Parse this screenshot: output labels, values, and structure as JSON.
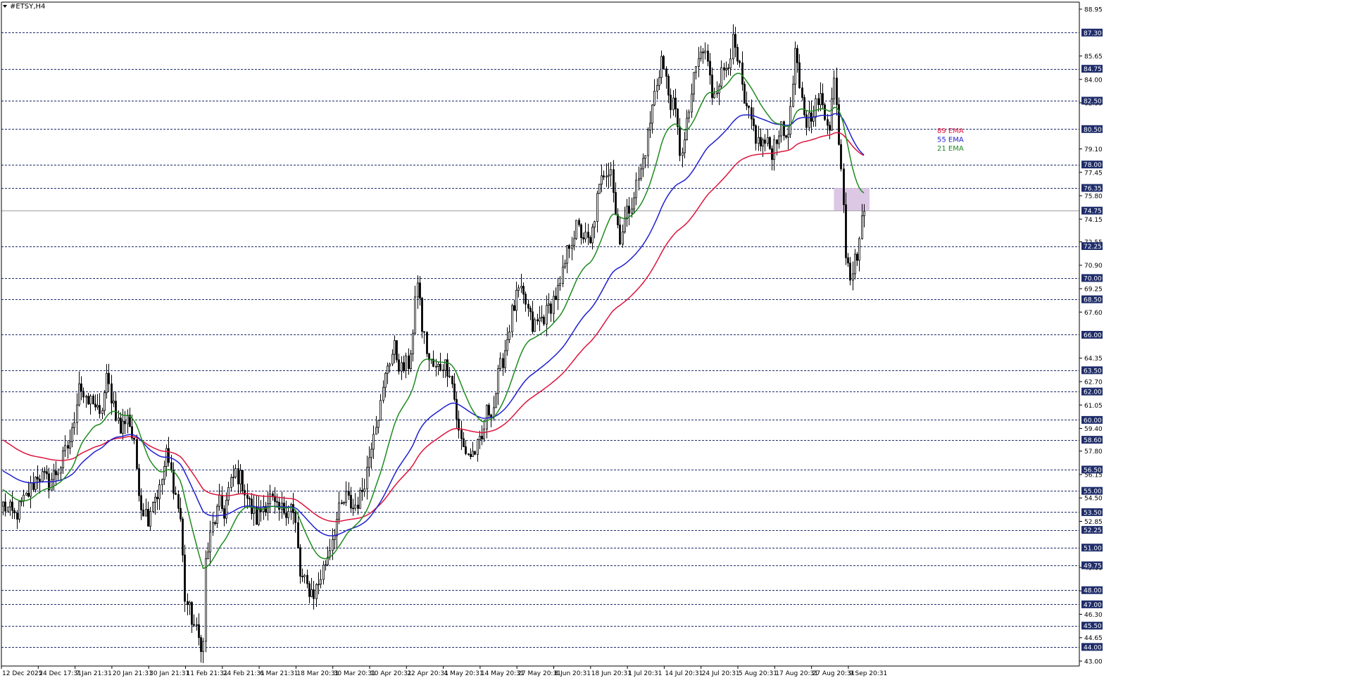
{
  "window": {
    "title": "#ETSY,H4",
    "menu_icon": "triangle-down-icon"
  },
  "chart_data": {
    "type": "candlestick",
    "symbol": "#ETSY",
    "timeframe": "H4",
    "ylim": [
      43.0,
      89.2
    ],
    "grid": "horizontal dashed levels",
    "y_ticks": [
      88.95,
      85.65,
      84.0,
      82.35,
      79.1,
      77.45,
      75.8,
      74.15,
      72.55,
      70.9,
      69.25,
      67.6,
      64.35,
      62.7,
      61.05,
      59.4,
      57.8,
      56.15,
      54.5,
      52.85,
      49.6,
      47.95,
      46.3,
      44.65,
      43.0
    ],
    "levels": [
      87.3,
      84.75,
      82.5,
      80.5,
      78.0,
      76.35,
      74.75,
      72.25,
      70.0,
      68.5,
      66.0,
      63.5,
      62.0,
      60.0,
      58.6,
      56.5,
      55.0,
      53.5,
      52.25,
      51.0,
      49.75,
      48.0,
      47.0,
      45.5,
      44.0
    ],
    "x_labels": [
      "12 Dec 2025",
      "24 Dec 17:31",
      "7 Jan 21:31",
      "20 Jan 21:31",
      "30 Jan 21:31",
      "11 Feb 21:31",
      "24 Feb 21:31",
      "6 Mar 21:31",
      "18 Mar 20:31",
      "30 Mar 20:31",
      "10 Apr 20:31",
      "22 Apr 20:31",
      "4 May 20:31",
      "14 May 20:31",
      "27 May 20:31",
      "8 Jun 20:31",
      "18 Jun 20:31",
      "1 Jul 20:31",
      "14 Jul 20:31",
      "24 Jul 20:31",
      "5 Aug 20:31",
      "17 Aug 20:31",
      "27 Aug 20:31",
      "9 Sep 20:31"
    ],
    "price_anchors": [
      [
        0,
        54.0
      ],
      [
        5,
        53.2
      ],
      [
        10,
        54.5
      ],
      [
        15,
        56.2
      ],
      [
        20,
        55.6
      ],
      [
        25,
        56.8
      ],
      [
        30,
        59.0
      ],
      [
        33,
        62.8
      ],
      [
        36,
        61.0
      ],
      [
        39,
        61.5
      ],
      [
        42,
        60.0
      ],
      [
        45,
        62.8
      ],
      [
        48,
        61.2
      ],
      [
        51,
        59.2
      ],
      [
        54,
        60.5
      ],
      [
        57,
        58.0
      ],
      [
        60,
        54.0
      ],
      [
        63,
        53.2
      ],
      [
        65,
        54.5
      ],
      [
        68,
        55.0
      ],
      [
        71,
        57.5
      ],
      [
        74,
        55.5
      ],
      [
        77,
        53.0
      ],
      [
        79,
        47.5
      ],
      [
        82,
        46.0
      ],
      [
        85,
        44.5
      ],
      [
        87,
        44.2
      ],
      [
        88,
        50.0
      ],
      [
        91,
        52.5
      ],
      [
        94,
        54.0
      ],
      [
        96,
        53.5
      ],
      [
        98,
        55.0
      ],
      [
        101,
        56.3
      ],
      [
        104,
        55.6
      ],
      [
        107,
        54.0
      ],
      [
        110,
        53.0
      ],
      [
        113,
        54.0
      ],
      [
        116,
        54.5
      ],
      [
        119,
        53.5
      ],
      [
        122,
        53.7
      ],
      [
        125,
        54.0
      ],
      [
        127,
        52.5
      ],
      [
        129,
        49.0
      ],
      [
        132,
        48.2
      ],
      [
        135,
        47.8
      ],
      [
        137,
        48.5
      ],
      [
        139,
        49.5
      ],
      [
        141,
        50.5
      ],
      [
        143,
        51.8
      ],
      [
        146,
        53.5
      ],
      [
        149,
        54.5
      ],
      [
        152,
        53.8
      ],
      [
        155,
        54.5
      ],
      [
        158,
        56.5
      ],
      [
        161,
        59.5
      ],
      [
        164,
        61.0
      ],
      [
        167,
        64.0
      ],
      [
        170,
        65.0
      ],
      [
        173,
        63.5
      ],
      [
        176,
        64.0
      ],
      [
        178,
        66.0
      ],
      [
        180,
        70.0
      ],
      [
        182,
        66.5
      ],
      [
        185,
        64.2
      ],
      [
        188,
        63.5
      ],
      [
        191,
        64.0
      ],
      [
        194,
        63.6
      ],
      [
        196,
        61.5
      ],
      [
        198,
        59.0
      ],
      [
        200,
        58.0
      ],
      [
        203,
        57.5
      ],
      [
        206,
        58.0
      ],
      [
        208,
        58.5
      ],
      [
        210,
        60.5
      ],
      [
        213,
        61.0
      ],
      [
        215,
        63.0
      ],
      [
        218,
        65.0
      ],
      [
        221,
        67.5
      ],
      [
        224,
        69.0
      ],
      [
        227,
        68.2
      ],
      [
        230,
        66.5
      ],
      [
        233,
        67.0
      ],
      [
        236,
        67.5
      ],
      [
        239,
        68.5
      ],
      [
        242,
        69.3
      ],
      [
        244,
        71.0
      ],
      [
        246,
        72.5
      ],
      [
        249,
        73.5
      ],
      [
        252,
        73.0
      ],
      [
        255,
        72.2
      ],
      [
        258,
        75.5
      ],
      [
        261,
        77.5
      ],
      [
        264,
        78.0
      ],
      [
        266,
        74.5
      ],
      [
        268,
        73.0
      ],
      [
        271,
        74.5
      ],
      [
        274,
        76.0
      ],
      [
        277,
        77.5
      ],
      [
        280,
        80.0
      ],
      [
        283,
        83.0
      ],
      [
        286,
        85.5
      ],
      [
        289,
        83.0
      ],
      [
        292,
        81.5
      ],
      [
        294,
        79.0
      ],
      [
        296,
        79.5
      ],
      [
        299,
        83.0
      ],
      [
        302,
        85.5
      ],
      [
        305,
        86.0
      ],
      [
        308,
        83.0
      ],
      [
        311,
        84.0
      ],
      [
        314,
        85.0
      ],
      [
        317,
        86.5
      ],
      [
        320,
        84.5
      ],
      [
        322,
        82.0
      ],
      [
        325,
        81.0
      ],
      [
        328,
        79.5
      ],
      [
        331,
        79.5
      ],
      [
        334,
        79.0
      ],
      [
        337,
        80.5
      ],
      [
        340,
        80.0
      ],
      [
        342,
        81.5
      ],
      [
        344,
        86.0
      ],
      [
        346,
        83.0
      ],
      [
        349,
        81.0
      ],
      [
        352,
        82.0
      ],
      [
        355,
        82.5
      ],
      [
        357,
        81.5
      ],
      [
        359,
        81.0
      ],
      [
        361,
        84.0
      ],
      [
        363,
        80.0
      ],
      [
        364,
        78.0
      ],
      [
        365,
        75.5
      ],
      [
        366,
        72.0
      ],
      [
        367,
        71.5
      ],
      [
        368,
        70.4
      ],
      [
        369,
        70.6
      ],
      [
        370,
        71.2
      ],
      [
        371,
        71.8
      ],
      [
        372,
        72.8
      ],
      [
        373,
        73.8
      ],
      [
        374,
        74.7
      ]
    ],
    "ema_init": {
      "ema89": 58.7,
      "ema55": 56.5,
      "ema21": 55.2
    },
    "series": [
      {
        "name": "89 EMA",
        "color": "#dc143c",
        "period": 89
      },
      {
        "name": "55 EMA",
        "color": "#1f1fd0",
        "period": 55
      },
      {
        "name": "21 EMA",
        "color": "#1f8a1f",
        "period": 21
      }
    ],
    "zone": {
      "from": 74.75,
      "to": 76.35
    },
    "current_price": 74.75,
    "level_color": "#1f2d6b",
    "candle_color": "#000000",
    "zone_color": "#d6bde0"
  }
}
